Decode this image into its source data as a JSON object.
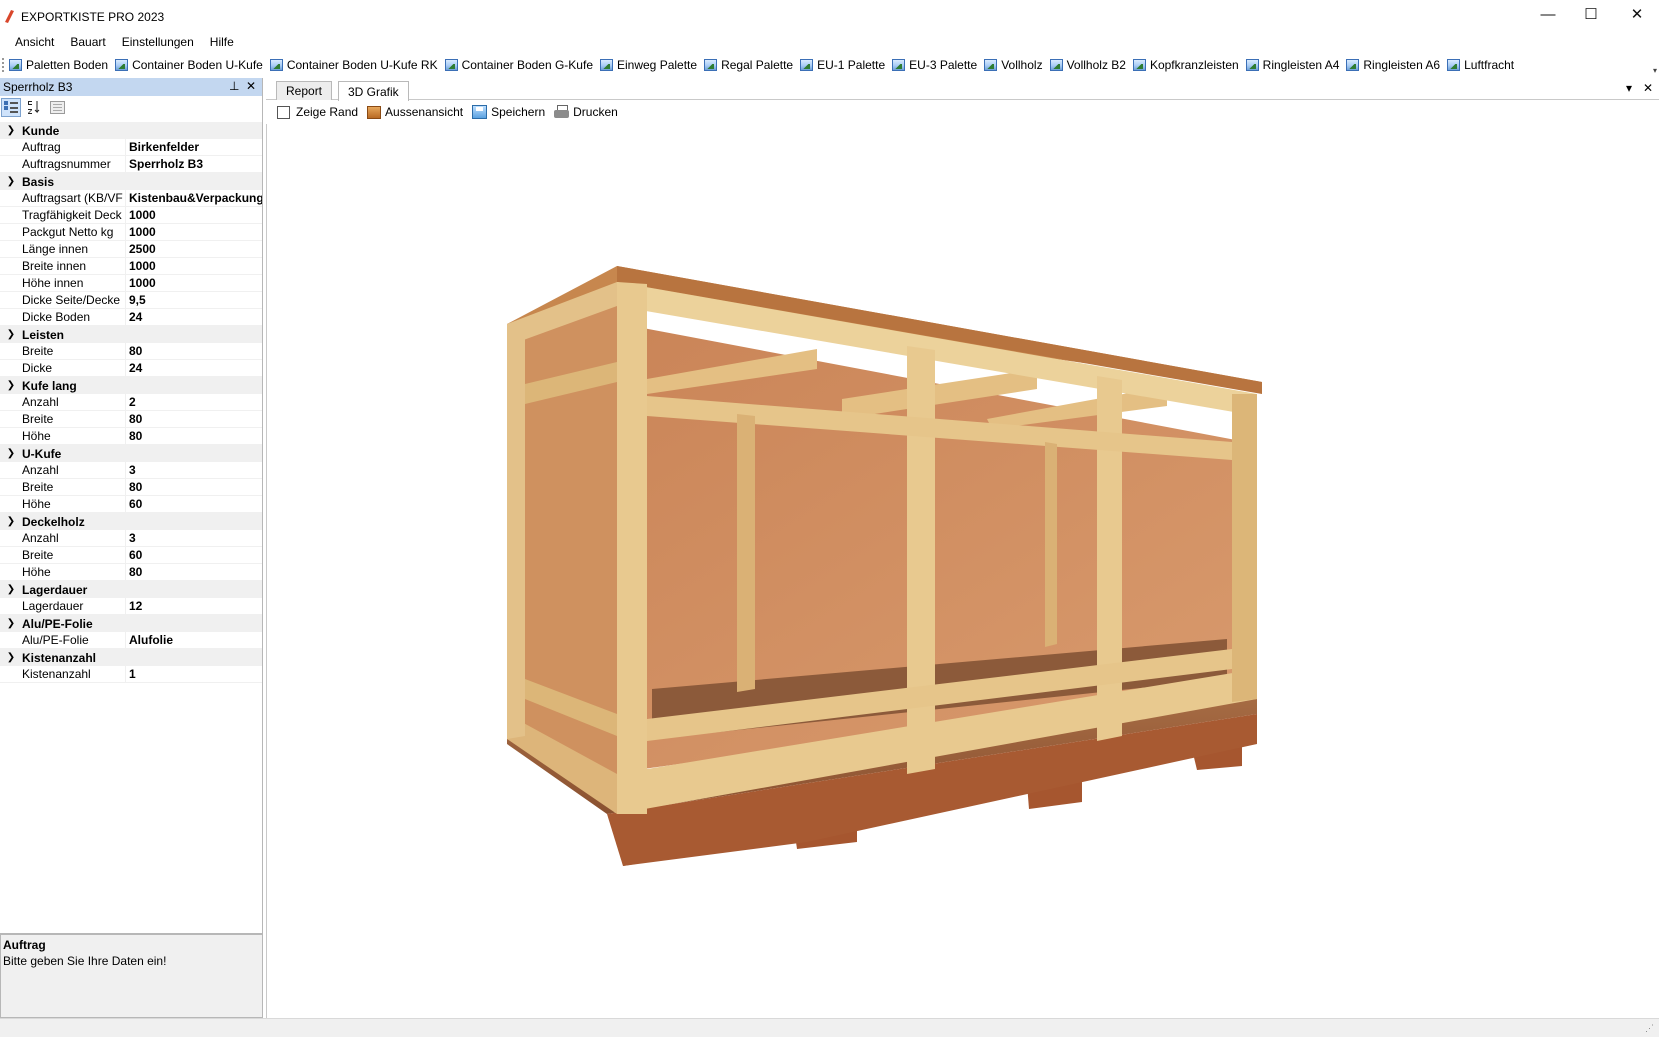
{
  "window": {
    "title": "EXPORTKISTE PRO 2023",
    "minimize_glyph": "—",
    "maximize_glyph": "☐",
    "close_glyph": "✕"
  },
  "menu": [
    "Ansicht",
    "Bauart",
    "Einstellungen",
    "Hilfe"
  ],
  "toolbar": {
    "items": [
      "Paletten Boden",
      "Container Boden U-Kufe",
      "Container Boden U-Kufe RK",
      "Container Boden G-Kufe",
      "Einweg Palette",
      "Regal Palette",
      "EU-1 Palette",
      "EU-3 Palette",
      "Vollholz",
      "Vollholz B2",
      "Kopfkranzleisten",
      "Ringleisten A4",
      "Ringleisten A6",
      "Luftfracht"
    ],
    "item_icon": "image-icon",
    "overflow_glyph": "▾"
  },
  "panel": {
    "title": "Sperrholz B3",
    "pin_glyph": "⊥",
    "close_glyph": "✕",
    "categories": [
      {
        "name": "Kunde",
        "rows": [
          {
            "label": "Auftrag",
            "value": "Birkenfelder"
          },
          {
            "label": "Auftragsnummer",
            "value": "Sperrholz B3"
          }
        ]
      },
      {
        "name": "Basis",
        "rows": [
          {
            "label": "Auftragsart (KB/VF",
            "value": "Kistenbau&Verpackung"
          },
          {
            "label": "Tragfähigkeit Deck",
            "value": "1000"
          },
          {
            "label": "Packgut Netto kg",
            "value": "1000"
          },
          {
            "label": "Länge innen",
            "value": "2500"
          },
          {
            "label": "Breite innen",
            "value": "1000"
          },
          {
            "label": "Höhe innen",
            "value": "1000"
          },
          {
            "label": "Dicke Seite/Decke",
            "value": "9,5"
          },
          {
            "label": "Dicke Boden",
            "value": "24"
          }
        ]
      },
      {
        "name": "Leisten",
        "rows": [
          {
            "label": "Breite",
            "value": "80"
          },
          {
            "label": "Dicke",
            "value": "24"
          }
        ]
      },
      {
        "name": "Kufe lang",
        "rows": [
          {
            "label": "Anzahl",
            "value": "2"
          },
          {
            "label": "Breite",
            "value": "80"
          },
          {
            "label": "Höhe",
            "value": "80"
          }
        ]
      },
      {
        "name": "U-Kufe",
        "rows": [
          {
            "label": "Anzahl",
            "value": "3"
          },
          {
            "label": "Breite",
            "value": "80"
          },
          {
            "label": "Höhe",
            "value": "60"
          }
        ]
      },
      {
        "name": "Deckelholz",
        "rows": [
          {
            "label": "Anzahl",
            "value": "3"
          },
          {
            "label": "Breite",
            "value": "60"
          },
          {
            "label": "Höhe",
            "value": "80"
          }
        ]
      },
      {
        "name": "Lagerdauer",
        "rows": [
          {
            "label": "Lagerdauer",
            "value": "12"
          }
        ]
      },
      {
        "name": "Alu/PE-Folie",
        "rows": [
          {
            "label": "Alu/PE-Folie",
            "value": "Alufolie"
          }
        ]
      },
      {
        "name": "Kistenanzahl",
        "rows": [
          {
            "label": "Kistenanzahl",
            "value": "1"
          }
        ]
      }
    ],
    "description": {
      "title": "Auftrag",
      "text": "Bitte geben Sie Ihre Daten ein!"
    }
  },
  "document": {
    "tabs": [
      {
        "label": "Report",
        "active": false
      },
      {
        "label": "3D Grafik",
        "active": true
      }
    ],
    "dropdown_glyph": "▾",
    "close_glyph": "✕",
    "tools": {
      "show_border": "Zeige Rand",
      "outside_view": "Aussenansicht",
      "save": "Speichern",
      "print": "Drucken"
    },
    "colors": {
      "frame_light": "#e8c98f",
      "frame_mid": "#d7ad6c",
      "panel_wood": "#c9835a",
      "skid_dark": "#9a4f2c"
    }
  }
}
